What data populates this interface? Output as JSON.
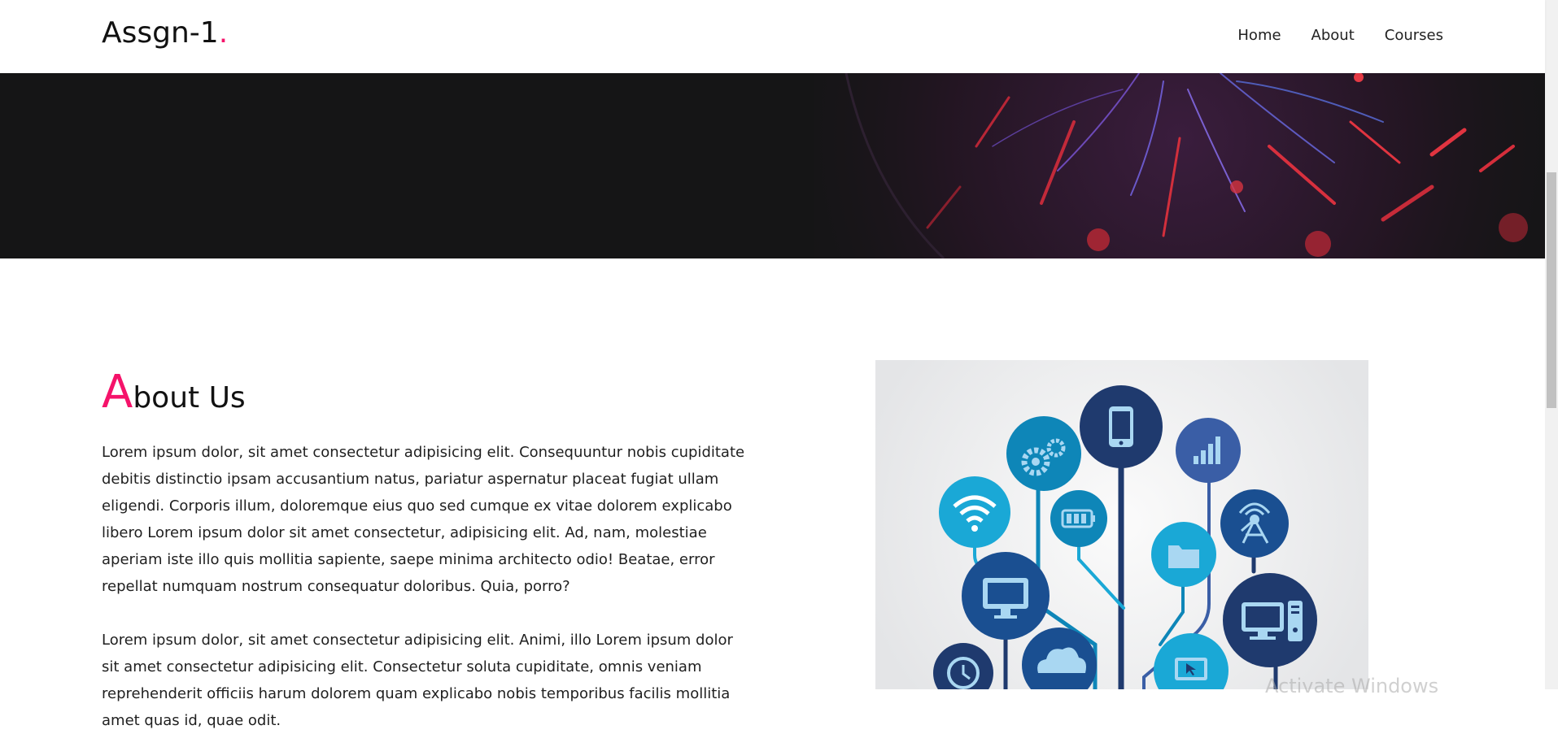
{
  "navbar": {
    "brand_text": "Assgn-1",
    "brand_dot": ".",
    "links": [
      {
        "label": "Home"
      },
      {
        "label": "About"
      },
      {
        "label": "Courses"
      }
    ]
  },
  "about": {
    "heading_first_letter": "A",
    "heading_rest": "bout Us",
    "paragraph1": "Lorem ipsum dolor, sit amet consectetur adipisicing elit. Consequuntur nobis cupiditate debitis distinctio ipsam accusantium natus, pariatur aspernatur placeat fugiat ullam eligendi. Corporis illum, doloremque eius quo sed cumque ex vitae dolorem explicabo libero Lorem ipsum dolor sit amet consectetur, adipisicing elit. Ad, nam, molestiae aperiam iste illo quis mollitia sapiente, saepe minima architecto odio! Beatae, error repellat numquam nostrum consequatur doloribus. Quia, porro?",
    "paragraph2": "Lorem ipsum dolor, sit amet consectetur adipisicing elit. Animi, illo Lorem ipsum dolor sit amet consectetur adipisicing elit. Consectetur soluta cupiditate, omnis veniam reprehenderit officiis harum dolorem quam explicabo nobis temporibus facilis mollitia amet quas id, quae odit."
  },
  "colors": {
    "accent": "#f5136a",
    "hero_bg": "#151516",
    "icon_dark": "#1f3a6e",
    "icon_mid": "#0e86b8",
    "icon_light": "#1aa8d6"
  },
  "icons": {
    "image_nodes": [
      "smartphone-icon",
      "gear-icon",
      "signal-bars-icon",
      "wifi-icon",
      "battery-icon",
      "antenna-icon",
      "folder-icon",
      "monitor-icon",
      "desktop-computer-icon",
      "clock-icon",
      "cloud-icon",
      "laptop-icon"
    ]
  },
  "watermark": "Activate Windows"
}
